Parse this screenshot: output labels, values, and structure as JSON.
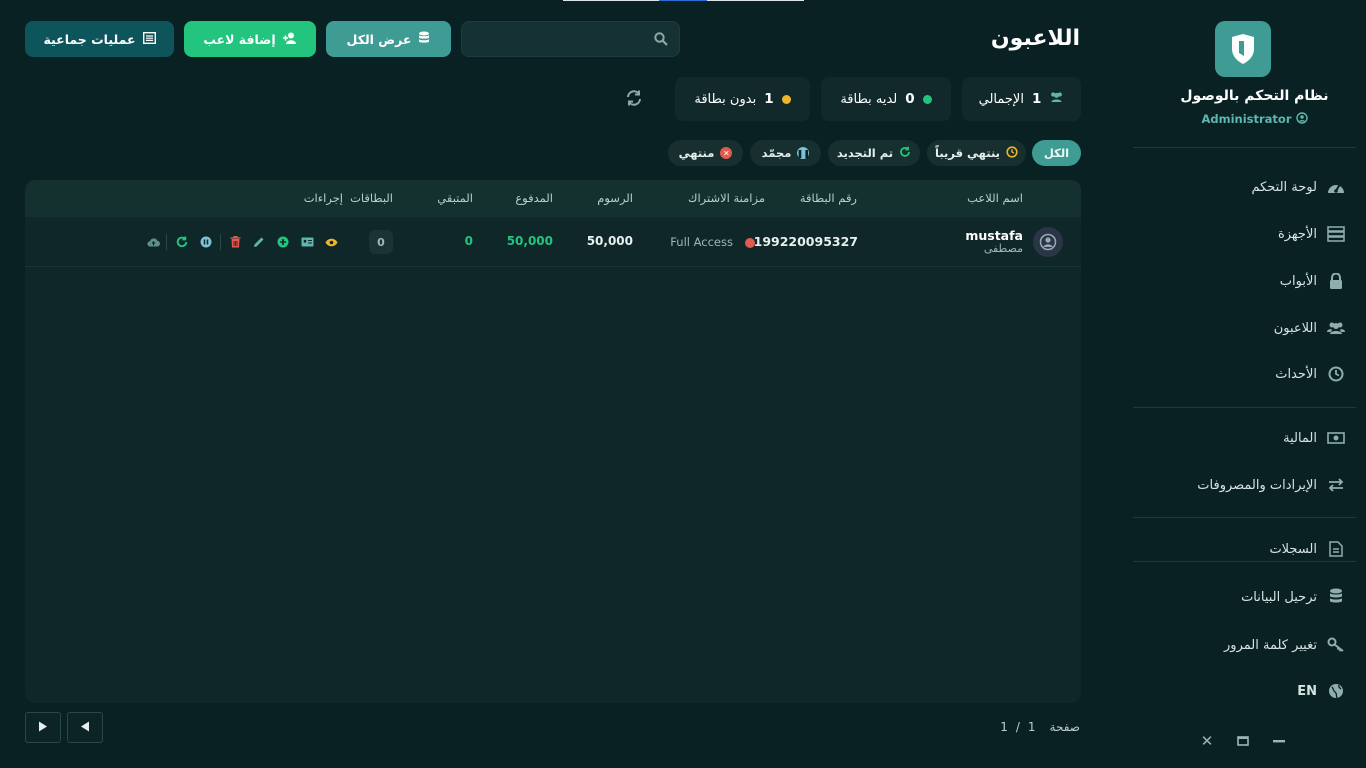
{
  "app": {
    "title": "نظام التحكم بالوصول",
    "role": "Administrator"
  },
  "sidebar": {
    "items": [
      {
        "label": "لوحة التحكم",
        "icon": "dashboard-icon"
      },
      {
        "label": "الأجهزة",
        "icon": "devices-icon"
      },
      {
        "label": "الأبواب",
        "icon": "lock-icon"
      },
      {
        "label": "اللاعبون",
        "icon": "users-icon"
      },
      {
        "label": "الأحداث",
        "icon": "clock-icon"
      },
      {
        "label": "المالية",
        "icon": "money-icon"
      },
      {
        "label": "الإيرادات والمصروفات",
        "icon": "exchange-icon"
      },
      {
        "label": "السجلات",
        "icon": "document-icon"
      },
      {
        "label": "ترحيل البيانات",
        "icon": "database-icon"
      },
      {
        "label": "تغيير كلمة المرور",
        "icon": "key-icon"
      },
      {
        "label": "EN",
        "icon": "globe-icon"
      }
    ]
  },
  "header": {
    "title": "اللاعبون",
    "search_placeholder": "",
    "view_all_label": "عرض الكل",
    "add_player_label": "إضافة لاعب",
    "bulk_label": "عمليات جماعية"
  },
  "stats": {
    "total": {
      "label": "الإجمالي",
      "value": "1"
    },
    "with_card": {
      "label": "لديه بطاقة",
      "value": "0"
    },
    "without_card": {
      "label": "بدون بطاقة",
      "value": "1"
    }
  },
  "filters": {
    "all": "الكل",
    "expiring": "ينتهي قريباً",
    "renewed": "تم التجديد",
    "frozen": "مجمّد",
    "expired": "منتهي"
  },
  "table": {
    "headers": {
      "name": "اسم اللاعب",
      "card": "رقم البطاقة",
      "sync": "مزامنة الاشتراك",
      "fee": "الرسوم",
      "paid": "المدفوع",
      "remaining": "المتبقي",
      "cards": "البطاقات",
      "actions": "إجراءات"
    },
    "rows": [
      {
        "name": "mustafa",
        "name_ar": "مصطفى",
        "card": "199220095327",
        "sync": "Full Access",
        "fee": "50,000",
        "paid": "50,000",
        "remaining": "0",
        "cards": "0"
      }
    ]
  },
  "pagination": {
    "label": "صفحة",
    "current": "1",
    "sep": "/",
    "total": "1"
  },
  "colors": {
    "accent": "#3f9c95",
    "success": "#23c47e",
    "danger": "#e05a4f",
    "warning": "#f0b429"
  }
}
